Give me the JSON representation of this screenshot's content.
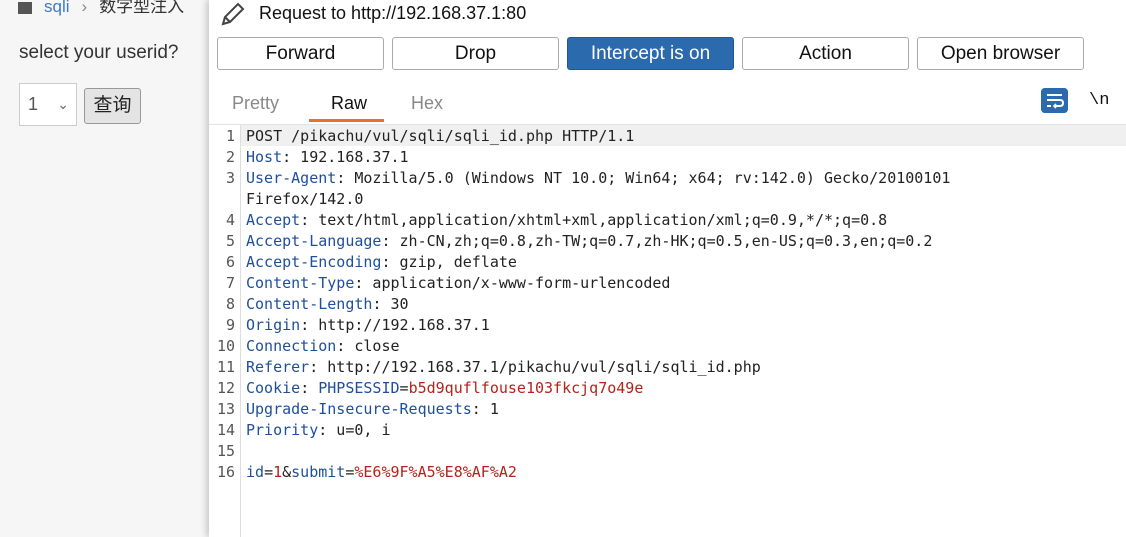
{
  "background_page": {
    "breadcrumb_link": "sqli",
    "breadcrumb_current": "数字型注入",
    "question": "select your userid?",
    "select_value": "1",
    "query_button": "查询"
  },
  "burp": {
    "title": "Request to http://192.168.37.1:80",
    "buttons": {
      "forward": "Forward",
      "drop": "Drop",
      "intercept": "Intercept is on",
      "action": "Action",
      "open_browser": "Open browser"
    },
    "tabs": {
      "pretty": "Pretty",
      "raw": "Raw",
      "hex": "Hex"
    },
    "newline_toggle": "\\n",
    "line_numbers": [
      "1",
      "2",
      "3",
      "",
      "4",
      "5",
      "6",
      "7",
      "8",
      "9",
      "10",
      "11",
      "12",
      "13",
      "14",
      "15",
      "16"
    ],
    "request": {
      "line1": "POST /pikachu/vul/sqli/sqli_id.php HTTP/1.1",
      "host_k": "Host",
      "host_v": ": 192.168.37.1",
      "ua_k": "User-Agent",
      "ua_v": ": Mozilla/5.0 (Windows NT 10.0; Win64; x64; rv:142.0) Gecko/20100101",
      "ua_v2": "Firefox/142.0",
      "accept_k": "Accept",
      "accept_v": ": text/html,application/xhtml+xml,application/xml;q=0.9,*/*;q=0.8",
      "lang_k": "Accept-Language",
      "lang_v": ": zh-CN,zh;q=0.8,zh-TW;q=0.7,zh-HK;q=0.5,en-US;q=0.3,en;q=0.2",
      "enc_k": "Accept-Encoding",
      "enc_v": ": gzip, deflate",
      "ctype_k": "Content-Type",
      "ctype_v": ": application/x-www-form-urlencoded",
      "clen_k": "Content-Length",
      "clen_v": ": 30",
      "origin_k": "Origin",
      "origin_v": ": http://192.168.37.1",
      "conn_k": "Connection",
      "conn_v": ": close",
      "ref_k": "Referer",
      "ref_v": ": http://192.168.37.1/pikachu/vul/sqli/sqli_id.php",
      "cookie_k": "Cookie",
      "cookie_sep": ": ",
      "cookie_name": "PHPSESSID",
      "cookie_eq": "=",
      "cookie_val": "b5d9quflfouse103fkcjq7o49e",
      "uir_k": "Upgrade-Insecure-Requests",
      "uir_v": ": 1",
      "prio_k": "Priority",
      "prio_v": ": u=0, i",
      "body_k1": "id",
      "body_eq1": "=",
      "body_v1": "1",
      "body_amp": "&",
      "body_k2": "submit",
      "body_eq2": "=",
      "body_v2": "%E6%9F%A5%E8%AF%A2"
    }
  }
}
